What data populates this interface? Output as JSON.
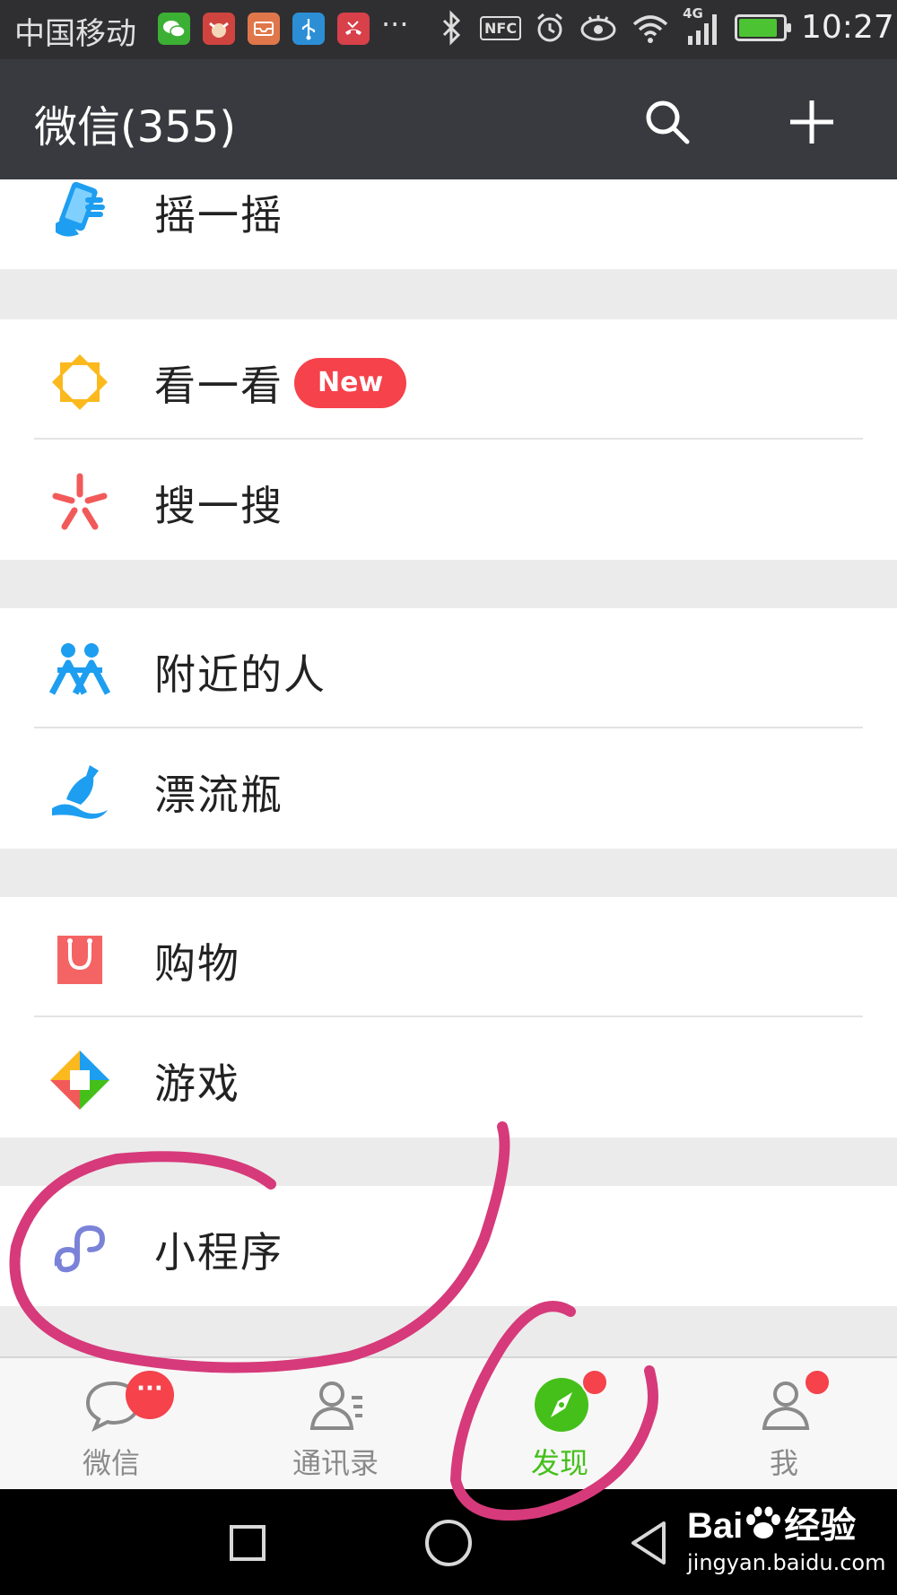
{
  "status_bar": {
    "carrier": "中国移动",
    "more": "···",
    "nfc": "NFC",
    "network": "4G",
    "time": "10:27"
  },
  "header": {
    "title": "微信(355)"
  },
  "menu": {
    "shake": "摇一摇",
    "top_stories": "看一看",
    "top_stories_badge": "New",
    "search": "搜一搜",
    "people_nearby": "附近的人",
    "drift_bottle": "漂流瓶",
    "shopping": "购物",
    "games": "游戏",
    "mini_programs": "小程序"
  },
  "tabs": {
    "chats": "微信",
    "chats_badge": "···",
    "contacts": "通讯录",
    "discover": "发现",
    "me": "我"
  },
  "colors": {
    "accent_green": "#45c01a",
    "badge_red": "#f5424b",
    "header_bg": "#393a3f",
    "annotation_pink": "#d63a7a"
  },
  "watermark": {
    "logo_prefix": "Bai",
    "logo_suffix": "经验",
    "url": "jingyan.baidu.com"
  }
}
